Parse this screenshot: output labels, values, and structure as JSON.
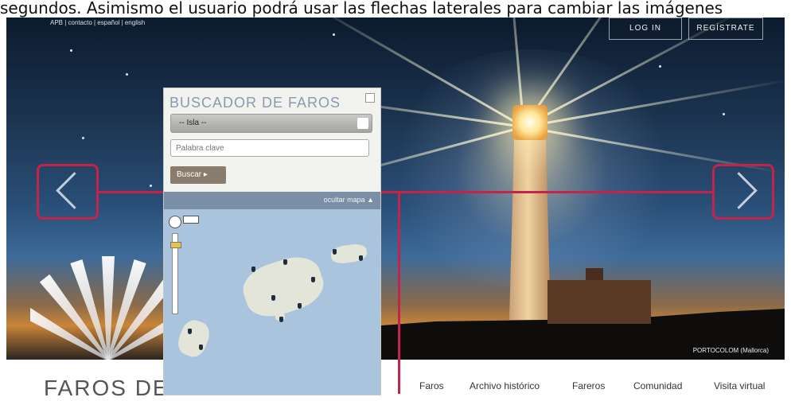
{
  "caption_text": "segundos. Asimismo el usuario podrá usar las flechas laterales para cambiar las imágenes",
  "topbar": {
    "links": "APB | contacto | español | english",
    "login_label": "LOG IN",
    "register_label": "REGÍSTRATE"
  },
  "hero": {
    "photo_caption": "PORTOCOLOM (Mallorca)",
    "icons": [
      "arrow-left-icon",
      "arrow-right-icon"
    ]
  },
  "search_panel": {
    "title": "BUSCADOR DE FAROS",
    "island_select_value": "-- Isla --",
    "keyword_placeholder": "Palabra clave",
    "search_button": "Buscar ▸",
    "hide_map": "ocultar mapa ▲"
  },
  "footer": {
    "brand": "FAROS DE",
    "nav": [
      "Faros",
      "Archivo histórico",
      "Fareros",
      "Comunidad",
      "Visita virtual"
    ]
  },
  "colors": {
    "highlight": "#c4244a",
    "panel_bg": "#f2f2ef",
    "map_water": "#a9c4dc"
  }
}
